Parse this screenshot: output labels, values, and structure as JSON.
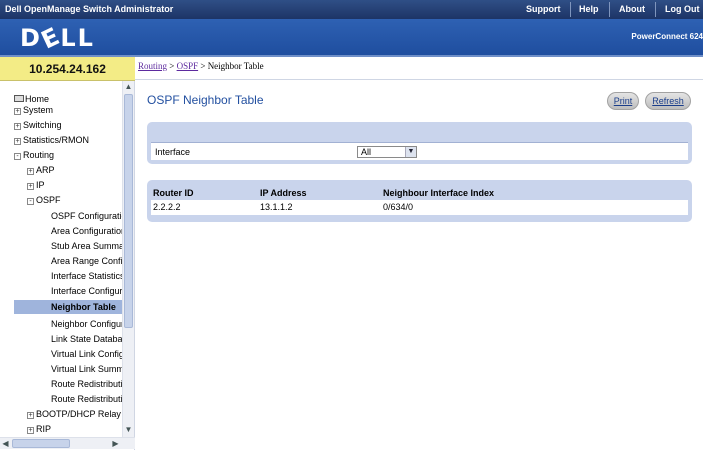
{
  "topbar": {
    "title": "Dell OpenManage Switch Administrator",
    "links": [
      "Support",
      "Help",
      "About",
      "Log Out"
    ]
  },
  "banner": {
    "logo": "DELL",
    "product": "PowerConnect 624"
  },
  "ip_address": "10.254.24.162",
  "breadcrumb": {
    "items": [
      "Routing",
      "OSPF"
    ],
    "current": "Neighbor Table",
    "separator": ">"
  },
  "nav": {
    "items": [
      {
        "label": "Home",
        "level": 0,
        "icon": "home-icon"
      },
      {
        "label": "System",
        "level": 0,
        "expander": "+"
      },
      {
        "label": "Switching",
        "level": 0,
        "expander": "+"
      },
      {
        "label": "Statistics/RMON",
        "level": 0,
        "expander": "+"
      },
      {
        "label": "Routing",
        "level": 0,
        "expander": "-"
      },
      {
        "label": "ARP",
        "level": 1,
        "expander": "+"
      },
      {
        "label": "IP",
        "level": 1,
        "expander": "+"
      },
      {
        "label": "OSPF",
        "level": 1,
        "expander": "-"
      },
      {
        "label": "OSPF Configuratic",
        "level": 2
      },
      {
        "label": "Area Configuration",
        "level": 2
      },
      {
        "label": "Stub Area Summa",
        "level": 2
      },
      {
        "label": "Area Range Config",
        "level": 2
      },
      {
        "label": "Interface Statistics",
        "level": 2
      },
      {
        "label": "Interface Configura",
        "level": 2
      },
      {
        "label": "Neighbor Table",
        "level": 2,
        "selected": true
      },
      {
        "label": "Neighbor Configura",
        "level": 2
      },
      {
        "label": "Link State Databa",
        "level": 2
      },
      {
        "label": "Virtual Link Config",
        "level": 2
      },
      {
        "label": "Virtual Link Summ",
        "level": 2
      },
      {
        "label": "Route Redistributic",
        "level": 2
      },
      {
        "label": "Route Redistributic",
        "level": 2
      },
      {
        "label": "BOOTP/DHCP Relay",
        "level": 1,
        "expander": "+"
      },
      {
        "label": "RIP",
        "level": 1,
        "expander": "+"
      }
    ]
  },
  "main": {
    "title": "OSPF Neighbor Table",
    "buttons": {
      "print": "Print",
      "refresh": "Refresh"
    },
    "filter": {
      "label": "Interface",
      "value": "All"
    },
    "table": {
      "columns": [
        "Router ID",
        "IP Address",
        "Neighbour Interface Index"
      ],
      "rows": [
        [
          "2.2.2.2",
          "13.1.1.2",
          "0/634/0"
        ]
      ]
    }
  },
  "colors": {
    "topbar": "#1d3466",
    "banner": "#2e61b3",
    "ip_box": "#f3ec86",
    "panel": "#c9d4ec",
    "title": "#2350a0",
    "selected_nav": "#9fb4dc"
  }
}
